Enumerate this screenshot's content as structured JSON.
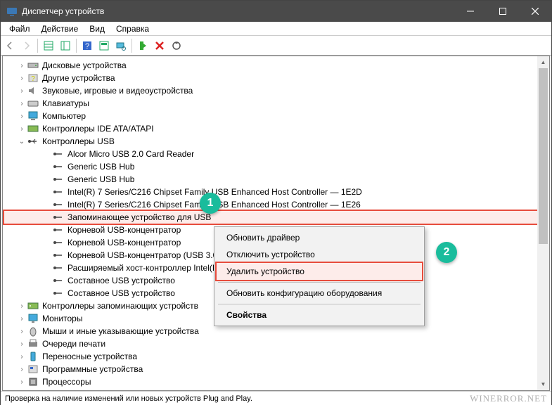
{
  "window": {
    "title": "Диспетчер устройств"
  },
  "menu": {
    "file": "Файл",
    "action": "Действие",
    "view": "Вид",
    "help": "Справка"
  },
  "tree": {
    "disk_drives": "Дисковые устройства",
    "other_devices": "Другие устройства",
    "sound_video": "Звуковые, игровые и видеоустройства",
    "keyboards": "Клавиатуры",
    "computer": "Компьютер",
    "ide_atapi": "Контроллеры IDE ATA/ATAPI",
    "usb_controllers": "Контроллеры USB",
    "usb": {
      "alcor": "Alcor Micro USB 2.0 Card Reader",
      "generic_hub_1": "Generic USB Hub",
      "generic_hub_2": "Generic USB Hub",
      "intel_2d": "Intel(R) 7 Series/C216 Chipset Family USB Enhanced Host Controller — 1E2D",
      "intel_26": "Intel(R) 7 Series/C216 Chipset Family USB Enhanced Host Controller — 1E26",
      "mass_storage": "Запоминающее устройство для USB",
      "root_hub_1": "Корневой USB-концентратор",
      "root_hub_2": "Корневой USB-концентратор",
      "root_hub_usb3": "Корневой USB-концентратор (USB 3.0)",
      "ext_host": "Расширяемый хост-контроллер Intel(R) USB 3.0",
      "composite_1": "Составное USB устройство",
      "composite_2": "Составное USB устройство"
    },
    "storage_controllers": "Контроллеры запоминающих устройств",
    "monitors": "Мониторы",
    "mice": "Мыши и иные указывающие устройства",
    "print_queues": "Очереди печати",
    "portable": "Переносные устройства",
    "software_devices": "Программные устройства",
    "processors": "Процессоры"
  },
  "context": {
    "update_driver": "Обновить драйвер",
    "disable_device": "Отключить устройство",
    "uninstall_device": "Удалить устройство",
    "scan_hardware": "Обновить конфигурацию оборудования",
    "properties": "Свойства"
  },
  "badges": {
    "one": "1",
    "two": "2"
  },
  "status": "Проверка на наличие изменений или новых устройств Plug and Play.",
  "watermark": "WINERROR.NET"
}
